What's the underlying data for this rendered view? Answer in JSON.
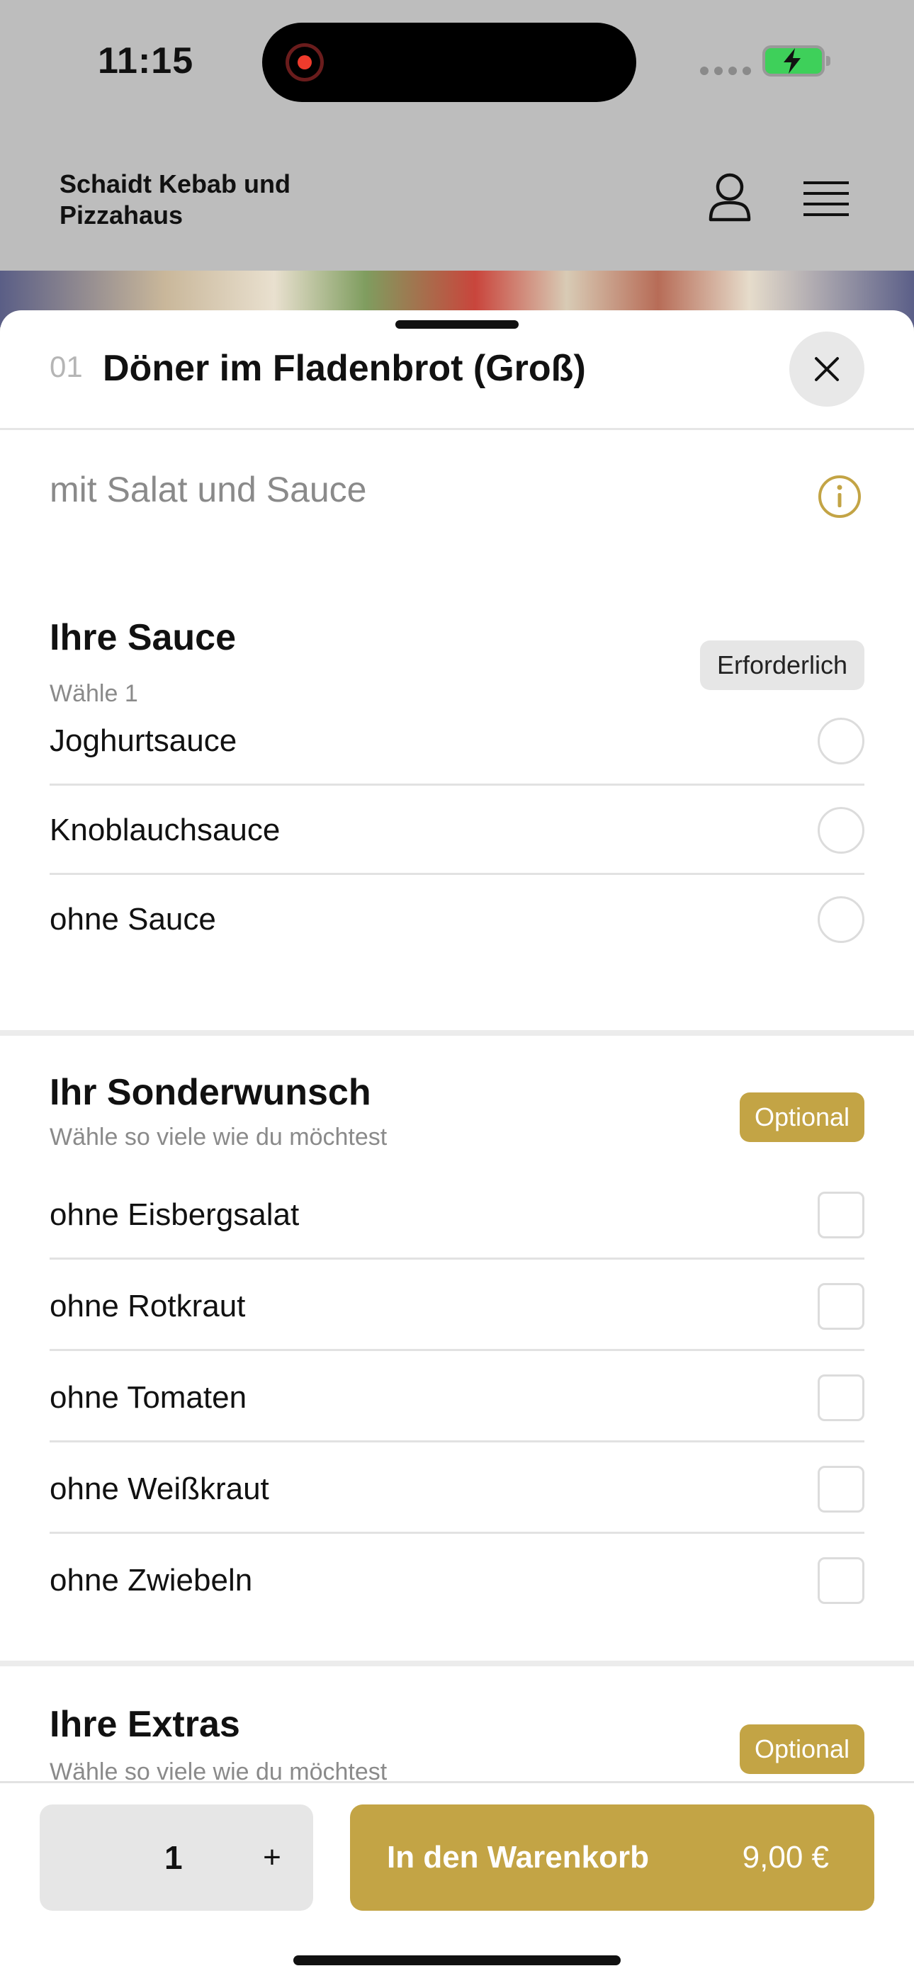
{
  "status_bar": {
    "time": "11:15"
  },
  "header": {
    "brand": "Schaidt Kebab und Pizzahaus"
  },
  "item": {
    "number": "01",
    "title": "Döner im Fladenbrot (Groß)",
    "description": "mit Salat und Sauce"
  },
  "sections": {
    "sauce": {
      "title": "Ihre Sauce",
      "subtitle": "Wähle 1",
      "badge": "Erforderlich",
      "options": [
        "Joghurtsauce",
        "Knoblauchsauce",
        "ohne Sauce"
      ]
    },
    "wish": {
      "title": "Ihr Sonderwunsch",
      "subtitle": "Wähle so viele wie du möchtest",
      "badge": "Optional",
      "options": [
        "ohne Eisbergsalat",
        "ohne Rotkraut",
        "ohne Tomaten",
        "ohne Weißkraut",
        "ohne Zwiebeln"
      ]
    },
    "extras": {
      "title": "Ihre Extras",
      "subtitle": "Wähle so viele wie du möchtest",
      "badge": "Optional"
    }
  },
  "footer": {
    "quantity": "1",
    "plus": "+",
    "cart_label": "In den Warenkorb",
    "price": "9,00 €"
  },
  "colors": {
    "accent": "#c3a445",
    "badge_required_bg": "#e6e6e6",
    "backdrop": "#bdbdbd"
  },
  "icons": [
    "user-icon",
    "menu-icon",
    "close-icon",
    "info-icon",
    "record-icon",
    "battery-charging-icon"
  ]
}
